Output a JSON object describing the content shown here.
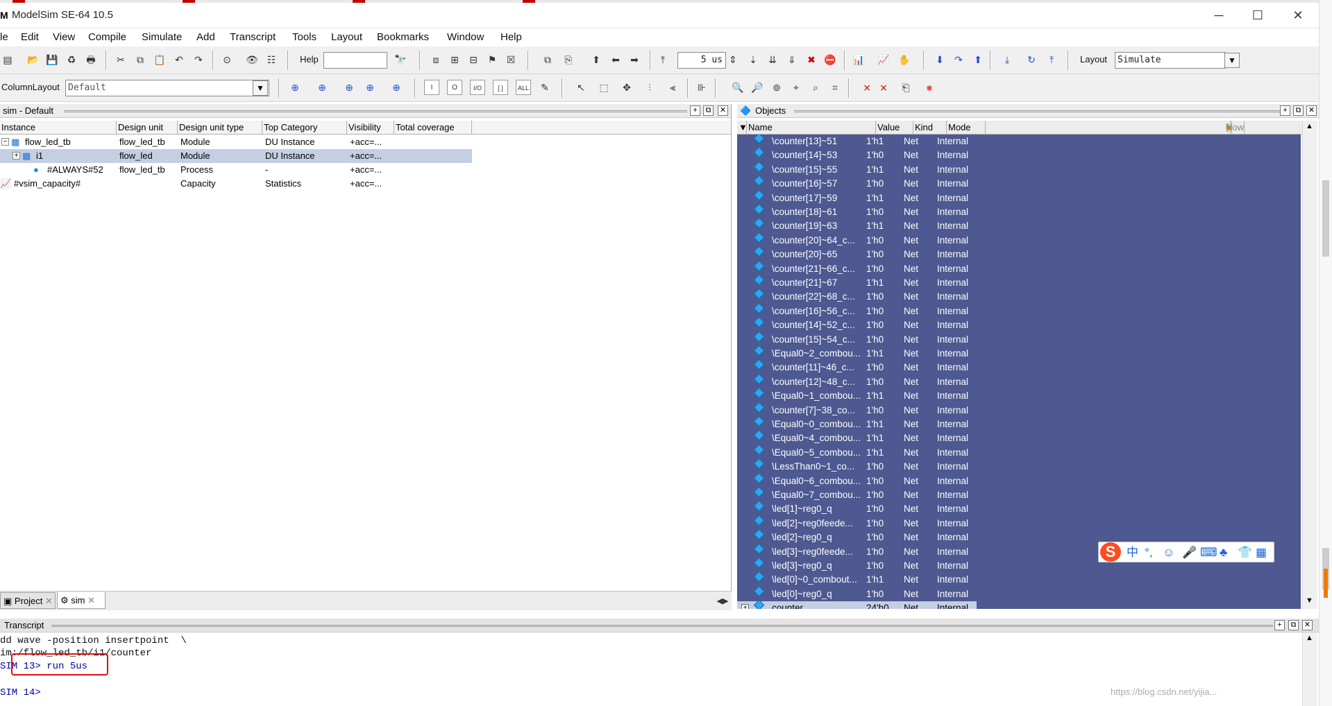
{
  "window": {
    "title": "ModelSim SE-64 10.5",
    "app_icon_glyph": "M",
    "controls": {
      "minimize": "─",
      "maximize": "☐",
      "close": "✕"
    }
  },
  "menu": [
    "le",
    "Edit",
    "View",
    "Compile",
    "Simulate",
    "Add",
    "Transcript",
    "Tools",
    "Layout",
    "Bookmarks",
    "Window",
    "Help"
  ],
  "toolbar1": {
    "help_label": "Help",
    "help_value": "",
    "run_length": "5 us",
    "layout_label": "Layout",
    "layout_value": "Simulate"
  },
  "toolbar2": {
    "column_layout_label": "ColumnLayout",
    "column_layout_value": "Default",
    "wave_buttons": [
      "I",
      "O",
      "I/O",
      "[ ]",
      "ALL"
    ]
  },
  "sim_pane": {
    "title": "sim - Default",
    "columns": [
      "Instance",
      "Design unit",
      "Design unit type",
      "Top Category",
      "Visibility",
      "Total coverage"
    ],
    "rows": [
      {
        "expander": "−",
        "instance": "flow_led_tb",
        "design_unit": "flow_led_tb",
        "type": "Module",
        "category": "DU Instance",
        "visibility": "+acc=...",
        "coverage": "",
        "icon": "module-icon",
        "indent": 1
      },
      {
        "expander": "+",
        "instance": "i1",
        "design_unit": "flow_led",
        "type": "Module",
        "category": "DU Instance",
        "visibility": "+acc=...",
        "coverage": "",
        "icon": "module-icon",
        "indent": 2,
        "selected": true
      },
      {
        "expander": "",
        "instance": "#ALWAYS#52",
        "design_unit": "flow_led_tb",
        "type": "Process",
        "category": "-",
        "visibility": "+acc=...",
        "coverage": "",
        "icon": "process-icon",
        "indent": 3
      },
      {
        "expander": "",
        "instance": "#vsim_capacity#",
        "design_unit": "",
        "type": "Capacity",
        "category": "Statistics",
        "visibility": "+acc=...",
        "coverage": "",
        "icon": "capacity-icon",
        "indent": 0
      }
    ],
    "tabs": [
      "Project",
      "sim"
    ]
  },
  "objects_pane": {
    "title": "Objects",
    "columns": [
      "Name",
      "Value",
      "Kind",
      "Mode"
    ],
    "now_label": "Now",
    "rows": [
      {
        "name": "\\counter[13]~51",
        "value": "1'h1",
        "kind": "Net",
        "mode": "Internal"
      },
      {
        "name": "\\counter[14]~53",
        "value": "1'h0",
        "kind": "Net",
        "mode": "Internal"
      },
      {
        "name": "\\counter[15]~55",
        "value": "1'h1",
        "kind": "Net",
        "mode": "Internal"
      },
      {
        "name": "\\counter[16]~57",
        "value": "1'h0",
        "kind": "Net",
        "mode": "Internal"
      },
      {
        "name": "\\counter[17]~59",
        "value": "1'h1",
        "kind": "Net",
        "mode": "Internal"
      },
      {
        "name": "\\counter[18]~61",
        "value": "1'h0",
        "kind": "Net",
        "mode": "Internal"
      },
      {
        "name": "\\counter[19]~63",
        "value": "1'h1",
        "kind": "Net",
        "mode": "Internal"
      },
      {
        "name": "\\counter[20]~64_c...",
        "value": "1'h0",
        "kind": "Net",
        "mode": "Internal"
      },
      {
        "name": "\\counter[20]~65",
        "value": "1'h0",
        "kind": "Net",
        "mode": "Internal"
      },
      {
        "name": "\\counter[21]~66_c...",
        "value": "1'h0",
        "kind": "Net",
        "mode": "Internal"
      },
      {
        "name": "\\counter[21]~67",
        "value": "1'h1",
        "kind": "Net",
        "mode": "Internal"
      },
      {
        "name": "\\counter[22]~68_c...",
        "value": "1'h0",
        "kind": "Net",
        "mode": "Internal"
      },
      {
        "name": "\\counter[16]~56_c...",
        "value": "1'h0",
        "kind": "Net",
        "mode": "Internal"
      },
      {
        "name": "\\counter[14]~52_c...",
        "value": "1'h0",
        "kind": "Net",
        "mode": "Internal"
      },
      {
        "name": "\\counter[15]~54_c...",
        "value": "1'h0",
        "kind": "Net",
        "mode": "Internal"
      },
      {
        "name": "\\Equal0~2_combou...",
        "value": "1'h1",
        "kind": "Net",
        "mode": "Internal"
      },
      {
        "name": "\\counter[11]~46_c...",
        "value": "1'h0",
        "kind": "Net",
        "mode": "Internal"
      },
      {
        "name": "\\counter[12]~48_c...",
        "value": "1'h0",
        "kind": "Net",
        "mode": "Internal"
      },
      {
        "name": "\\Equal0~1_combou...",
        "value": "1'h1",
        "kind": "Net",
        "mode": "Internal"
      },
      {
        "name": "\\counter[7]~38_co...",
        "value": "1'h0",
        "kind": "Net",
        "mode": "Internal"
      },
      {
        "name": "\\Equal0~0_combou...",
        "value": "1'h1",
        "kind": "Net",
        "mode": "Internal"
      },
      {
        "name": "\\Equal0~4_combou...",
        "value": "1'h1",
        "kind": "Net",
        "mode": "Internal"
      },
      {
        "name": "\\Equal0~5_combou...",
        "value": "1'h1",
        "kind": "Net",
        "mode": "Internal"
      },
      {
        "name": "\\LessThan0~1_co...",
        "value": "1'h0",
        "kind": "Net",
        "mode": "Internal"
      },
      {
        "name": "\\Equal0~6_combou...",
        "value": "1'h0",
        "kind": "Net",
        "mode": "Internal"
      },
      {
        "name": "\\Equal0~7_combou...",
        "value": "1'h0",
        "kind": "Net",
        "mode": "Internal"
      },
      {
        "name": "\\led[1]~reg0_q",
        "value": "1'h0",
        "kind": "Net",
        "mode": "Internal"
      },
      {
        "name": "\\led[2]~reg0feede...",
        "value": "1'h0",
        "kind": "Net",
        "mode": "Internal"
      },
      {
        "name": "\\led[2]~reg0_q",
        "value": "1'h0",
        "kind": "Net",
        "mode": "Internal"
      },
      {
        "name": "\\led[3]~reg0feede...",
        "value": "1'h0",
        "kind": "Net",
        "mode": "Internal"
      },
      {
        "name": "\\led[3]~reg0_q",
        "value": "1'h0",
        "kind": "Net",
        "mode": "Internal"
      },
      {
        "name": "\\led[0]~0_combout...",
        "value": "1'h1",
        "kind": "Net",
        "mode": "Internal"
      },
      {
        "name": "\\led[0]~reg0_q",
        "value": "1'h0",
        "kind": "Net",
        "mode": "Internal"
      },
      {
        "name": "counter",
        "value": "24'h0...",
        "kind": "Net",
        "mode": "Internal",
        "expander": "+",
        "selected": true
      }
    ]
  },
  "transcript": {
    "title": "Transcript",
    "lines": [
      "dd wave -position insertpoint  \\",
      "im:/flow_led_tb/i1/counter",
      "SIM 13> run 5us",
      "",
      "SIM 14>"
    ]
  },
  "ime": {
    "logo": "S",
    "chars": [
      "中",
      "°,",
      "☺",
      "🎤",
      "⌨",
      "♣",
      "👕",
      "▦"
    ]
  },
  "watermark": "https://blog.csdn.net/yijia...",
  "colors": {
    "objects_bg": "#4d5990",
    "selection": "#c5cfe3",
    "highlight_box": "#e01010"
  }
}
